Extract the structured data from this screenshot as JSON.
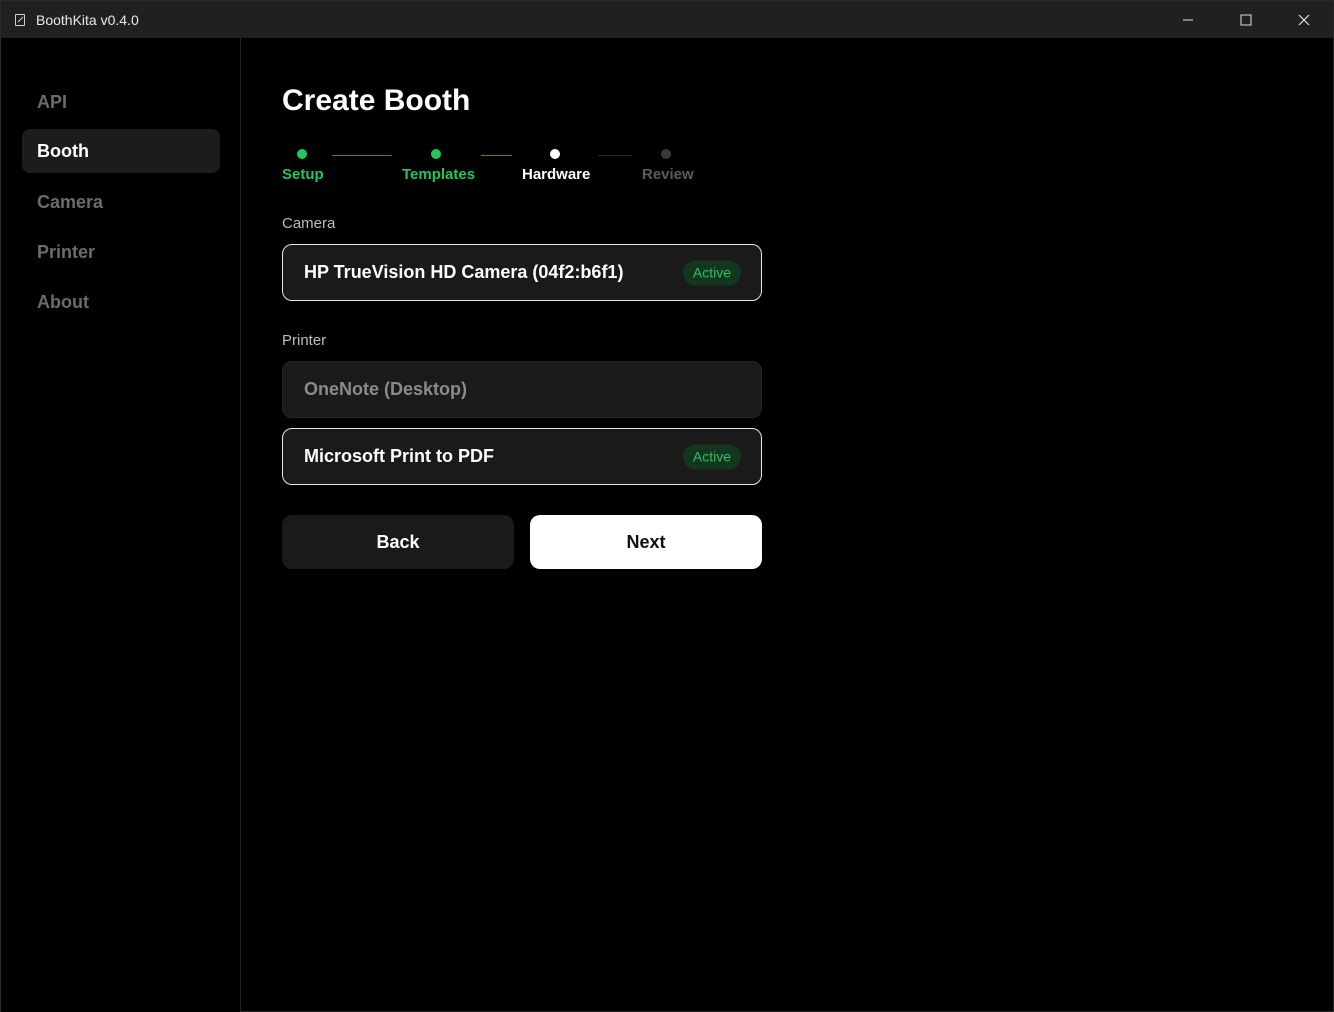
{
  "window": {
    "title": "BoothKita v0.4.0"
  },
  "sidebar": {
    "items": [
      {
        "label": "API",
        "active": false
      },
      {
        "label": "Booth",
        "active": true
      },
      {
        "label": "Camera",
        "active": false
      },
      {
        "label": "Printer",
        "active": false
      },
      {
        "label": "About",
        "active": false
      }
    ]
  },
  "page": {
    "title": "Create Booth"
  },
  "stepper": {
    "steps": [
      {
        "label": "Setup",
        "state": "complete"
      },
      {
        "label": "Templates",
        "state": "complete"
      },
      {
        "label": "Hardware",
        "state": "current"
      },
      {
        "label": "Review",
        "state": "pending"
      }
    ]
  },
  "camera": {
    "label": "Camera",
    "devices": [
      {
        "name": "HP TrueVision HD Camera (04f2:b6f1)",
        "badge": "Active",
        "selected": true
      }
    ]
  },
  "printer": {
    "label": "Printer",
    "devices": [
      {
        "name": "OneNote (Desktop)",
        "badge": "",
        "selected": false
      },
      {
        "name": "Microsoft Print to PDF",
        "badge": "Active",
        "selected": true
      }
    ]
  },
  "actions": {
    "back_label": "Back",
    "next_label": "Next"
  },
  "colors": {
    "accent_green": "#22c55e",
    "badge_bg": "#12361e",
    "badge_text": "#2fc15f",
    "titlebar_bg": "#202020",
    "background": "#000000"
  }
}
